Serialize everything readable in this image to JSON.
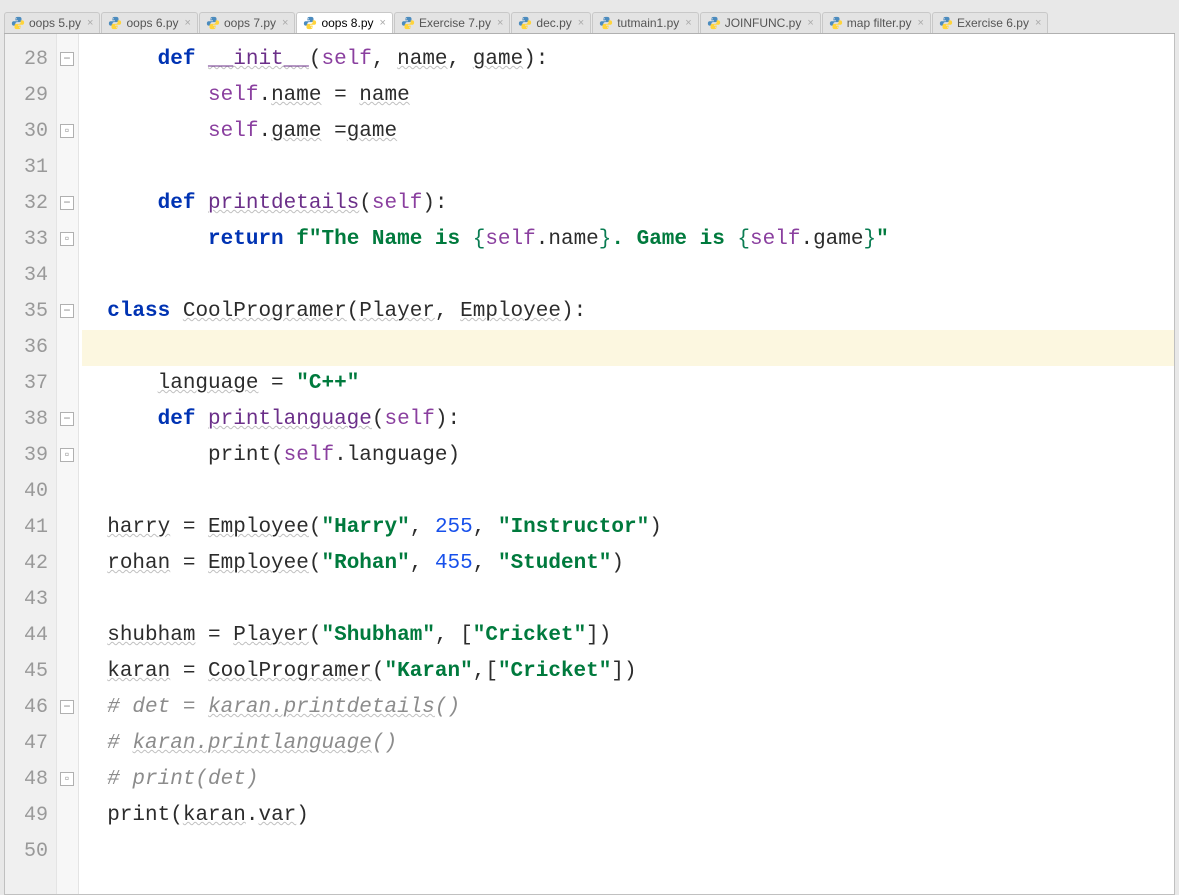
{
  "tabs": [
    {
      "label": "oops 5.py",
      "active": false
    },
    {
      "label": "oops 6.py",
      "active": false
    },
    {
      "label": "oops 7.py",
      "active": false
    },
    {
      "label": "oops 8.py",
      "active": true
    },
    {
      "label": "Exercise 7.py",
      "active": false
    },
    {
      "label": "dec.py",
      "active": false
    },
    {
      "label": "tutmain1.py",
      "active": false
    },
    {
      "label": "JOINFUNC.py",
      "active": false
    },
    {
      "label": "map filter.py",
      "active": false
    },
    {
      "label": "Exercise 6.py",
      "active": false
    }
  ],
  "line_start": 28,
  "line_end": 50,
  "current_line": 36,
  "code_lines": [
    {
      "n": 28,
      "indent": "      ",
      "tokens": [
        [
          "kw",
          "def"
        ],
        [
          "op",
          " "
        ],
        [
          "fn wavy",
          "__init__"
        ],
        [
          "op",
          "("
        ],
        [
          "self",
          "self"
        ],
        [
          "op",
          ", "
        ],
        [
          "ident wavy",
          "name"
        ],
        [
          "op",
          ", "
        ],
        [
          "ident wavy",
          "game"
        ],
        [
          "op",
          ")"
        ],
        [
          "op",
          ":"
        ]
      ]
    },
    {
      "n": 29,
      "indent": "          ",
      "tokens": [
        [
          "self",
          "self"
        ],
        [
          "op",
          "."
        ],
        [
          "ident wavy",
          "name"
        ],
        [
          "op",
          " = "
        ],
        [
          "ident wavy",
          "name"
        ]
      ]
    },
    {
      "n": 30,
      "indent": "          ",
      "tokens": [
        [
          "self",
          "self"
        ],
        [
          "op",
          "."
        ],
        [
          "ident wavy",
          "game"
        ],
        [
          "op",
          " ="
        ],
        [
          "ident wavy",
          "game"
        ]
      ]
    },
    {
      "n": 31,
      "indent": "",
      "tokens": []
    },
    {
      "n": 32,
      "indent": "      ",
      "tokens": [
        [
          "kw",
          "def"
        ],
        [
          "op",
          " "
        ],
        [
          "fn wavy",
          "printdetails"
        ],
        [
          "op",
          "("
        ],
        [
          "self",
          "self"
        ],
        [
          "op",
          ")"
        ],
        [
          "op",
          ":"
        ]
      ]
    },
    {
      "n": 33,
      "indent": "          ",
      "tokens": [
        [
          "kw",
          "return"
        ],
        [
          "op",
          " "
        ],
        [
          "str",
          "f\""
        ],
        [
          "str fname-bold",
          "The Name is "
        ],
        [
          "fstrbrace",
          "{"
        ],
        [
          "self",
          "self"
        ],
        [
          "op",
          "."
        ],
        [
          "ident",
          "name"
        ],
        [
          "fstrbrace",
          "}"
        ],
        [
          "str fname-bold",
          ". Game is "
        ],
        [
          "fstrbrace",
          "{"
        ],
        [
          "self",
          "self"
        ],
        [
          "op",
          "."
        ],
        [
          "ident",
          "game"
        ],
        [
          "fstrbrace",
          "}"
        ],
        [
          "str",
          "\""
        ]
      ]
    },
    {
      "n": 34,
      "indent": "",
      "tokens": []
    },
    {
      "n": 35,
      "indent": "  ",
      "tokens": [
        [
          "kw",
          "class"
        ],
        [
          "op",
          " "
        ],
        [
          "ident wavy",
          "CoolProgramer"
        ],
        [
          "op",
          "("
        ],
        [
          "ident wavy",
          "Player"
        ],
        [
          "op",
          ", "
        ],
        [
          "ident wavy",
          "Employee"
        ],
        [
          "op",
          ")"
        ],
        [
          "op",
          ":"
        ]
      ]
    },
    {
      "n": 36,
      "indent": "",
      "tokens": [],
      "hl": true
    },
    {
      "n": 37,
      "indent": "      ",
      "tokens": [
        [
          "ident wavy",
          "language"
        ],
        [
          "op",
          " = "
        ],
        [
          "str",
          "\""
        ],
        [
          "str fname-bold",
          "C++"
        ],
        [
          "str",
          "\""
        ]
      ]
    },
    {
      "n": 38,
      "indent": "      ",
      "tokens": [
        [
          "kw",
          "def"
        ],
        [
          "op",
          " "
        ],
        [
          "fn wavy",
          "printlanguage"
        ],
        [
          "op",
          "("
        ],
        [
          "self",
          "self"
        ],
        [
          "op",
          ")"
        ],
        [
          "op",
          ":"
        ]
      ]
    },
    {
      "n": 39,
      "indent": "          ",
      "tokens": [
        [
          "ident",
          "print"
        ],
        [
          "op",
          "("
        ],
        [
          "self",
          "self"
        ],
        [
          "op",
          "."
        ],
        [
          "ident",
          "language"
        ],
        [
          "op",
          ")"
        ]
      ]
    },
    {
      "n": 40,
      "indent": "",
      "tokens": []
    },
    {
      "n": 41,
      "indent": "  ",
      "tokens": [
        [
          "ident wavy",
          "harry"
        ],
        [
          "op",
          " = "
        ],
        [
          "ident wavy",
          "Employee"
        ],
        [
          "op",
          "("
        ],
        [
          "str",
          "\""
        ],
        [
          "str fname-bold",
          "Harry"
        ],
        [
          "str",
          "\""
        ],
        [
          "op",
          ", "
        ],
        [
          "num",
          "255"
        ],
        [
          "op",
          ", "
        ],
        [
          "str",
          "\""
        ],
        [
          "str fname-bold",
          "Instructor"
        ],
        [
          "str",
          "\""
        ],
        [
          "op",
          ")"
        ]
      ]
    },
    {
      "n": 42,
      "indent": "  ",
      "tokens": [
        [
          "ident wavy",
          "rohan"
        ],
        [
          "op",
          " = "
        ],
        [
          "ident wavy",
          "Employee"
        ],
        [
          "op",
          "("
        ],
        [
          "str",
          "\""
        ],
        [
          "str fname-bold",
          "Rohan"
        ],
        [
          "str",
          "\""
        ],
        [
          "op",
          ", "
        ],
        [
          "num",
          "455"
        ],
        [
          "op",
          ", "
        ],
        [
          "str",
          "\""
        ],
        [
          "str fname-bold",
          "Student"
        ],
        [
          "str",
          "\""
        ],
        [
          "op",
          ")"
        ]
      ]
    },
    {
      "n": 43,
      "indent": "",
      "tokens": []
    },
    {
      "n": 44,
      "indent": "  ",
      "tokens": [
        [
          "ident wavy",
          "shubham"
        ],
        [
          "op",
          " = "
        ],
        [
          "ident wavy",
          "Player"
        ],
        [
          "op",
          "("
        ],
        [
          "str",
          "\""
        ],
        [
          "str fname-bold",
          "Shubham"
        ],
        [
          "str",
          "\""
        ],
        [
          "op",
          ", ["
        ],
        [
          "str",
          "\""
        ],
        [
          "str fname-bold",
          "Cricket"
        ],
        [
          "str",
          "\""
        ],
        [
          "op",
          "])"
        ]
      ]
    },
    {
      "n": 45,
      "indent": "  ",
      "tokens": [
        [
          "ident wavy",
          "karan"
        ],
        [
          "op",
          " = "
        ],
        [
          "ident wavy",
          "CoolProgramer"
        ],
        [
          "op",
          "("
        ],
        [
          "str",
          "\""
        ],
        [
          "str fname-bold",
          "Karan"
        ],
        [
          "str",
          "\""
        ],
        [
          "op",
          ",["
        ],
        [
          "str",
          "\""
        ],
        [
          "str fname-bold",
          "Cricket"
        ],
        [
          "str",
          "\""
        ],
        [
          "op",
          "])"
        ]
      ]
    },
    {
      "n": 46,
      "indent": "  ",
      "tokens": [
        [
          "cmt",
          "# det = "
        ],
        [
          "cmt wavy",
          "karan.printdetails"
        ],
        [
          "cmt",
          "()"
        ]
      ]
    },
    {
      "n": 47,
      "indent": "  ",
      "tokens": [
        [
          "cmt",
          "# "
        ],
        [
          "cmt wavy",
          "karan.printlanguage"
        ],
        [
          "cmt",
          "()"
        ]
      ]
    },
    {
      "n": 48,
      "indent": "  ",
      "tokens": [
        [
          "cmt",
          "# print(det)"
        ]
      ]
    },
    {
      "n": 49,
      "indent": "  ",
      "tokens": [
        [
          "ident",
          "print"
        ],
        [
          "op",
          "("
        ],
        [
          "ident wavy",
          "karan"
        ],
        [
          "op",
          "."
        ],
        [
          "ident wavy",
          "var"
        ],
        [
          "op",
          ")"
        ]
      ]
    },
    {
      "n": 50,
      "indent": "",
      "tokens": []
    }
  ],
  "fold_markers": [
    {
      "line": 28,
      "type": "open"
    },
    {
      "line": 30,
      "type": "close"
    },
    {
      "line": 32,
      "type": "open"
    },
    {
      "line": 33,
      "type": "close"
    },
    {
      "line": 35,
      "type": "open"
    },
    {
      "line": 38,
      "type": "open"
    },
    {
      "line": 39,
      "type": "close"
    },
    {
      "line": 46,
      "type": "open"
    },
    {
      "line": 48,
      "type": "close"
    }
  ]
}
